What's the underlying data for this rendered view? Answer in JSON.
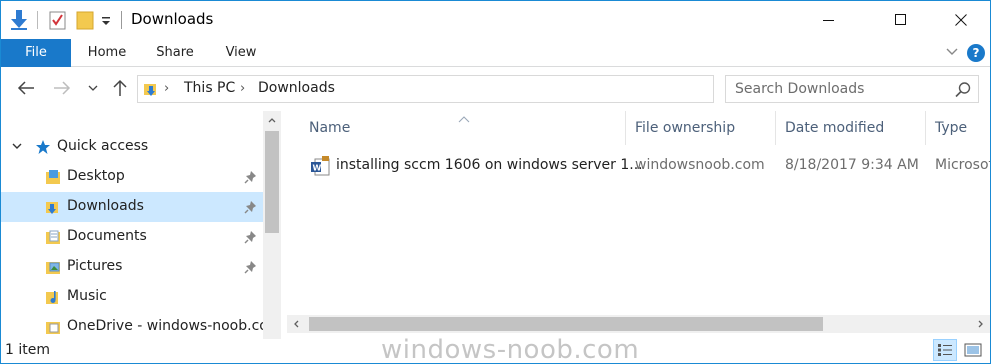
{
  "window": {
    "title": "Downloads"
  },
  "ribbon": {
    "tabs": [
      {
        "label": "File"
      },
      {
        "label": "Home"
      },
      {
        "label": "Share"
      },
      {
        "label": "View"
      }
    ],
    "help_label": "?"
  },
  "address": {
    "crumbs": [
      "This PC",
      "Downloads"
    ],
    "search_placeholder": "Search Downloads"
  },
  "nav": {
    "quick_access": "Quick access",
    "items": [
      {
        "label": "Desktop",
        "pinned": true,
        "icon": "desktop-folder-icon"
      },
      {
        "label": "Downloads",
        "pinned": true,
        "icon": "downloads-folder-icon",
        "selected": true
      },
      {
        "label": "Documents",
        "pinned": true,
        "icon": "documents-folder-icon"
      },
      {
        "label": "Pictures",
        "pinned": true,
        "icon": "pictures-folder-icon"
      },
      {
        "label": "Music",
        "pinned": false,
        "icon": "music-folder-icon"
      },
      {
        "label": "OneDrive - windows-noob.co",
        "pinned": false,
        "icon": "onedrive-folder-icon"
      }
    ]
  },
  "files": {
    "columns": [
      {
        "label": "Name"
      },
      {
        "label": "File ownership"
      },
      {
        "label": "Date modified"
      },
      {
        "label": "Type"
      }
    ],
    "rows": [
      {
        "name": "installing sccm 1606 on windows server 1...",
        "ownership": "windowsnoob.com",
        "modified": "8/18/2017 9:34 AM",
        "type": "Microsof",
        "icon": "word-document-icon"
      }
    ]
  },
  "status": {
    "item_count": "1 item"
  },
  "watermark": "windows-noob.com",
  "colors": {
    "accent": "#1979ca",
    "selection": "#cce8ff",
    "header_text": "#4c607a"
  }
}
